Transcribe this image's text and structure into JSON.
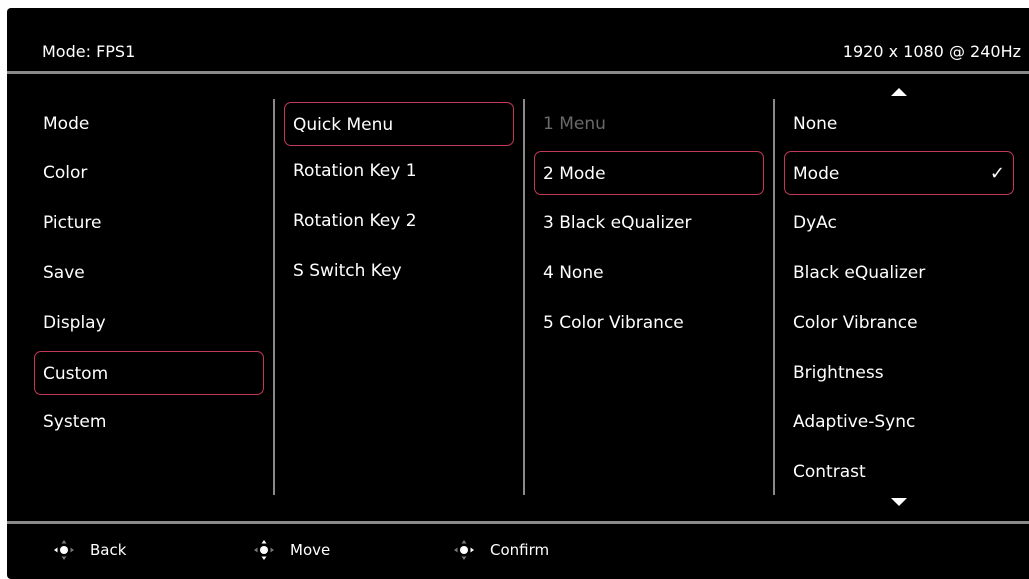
{
  "header": {
    "mode_label": "Mode: FPS1",
    "resolution": "1920 x 1080 @ 240Hz"
  },
  "menu": {
    "level1": [
      "Mode",
      "Color",
      "Picture",
      "Save",
      "Display",
      "Custom",
      "System"
    ],
    "level1_selected": "Custom",
    "level2": [
      "Quick Menu",
      "Rotation Key 1",
      "Rotation Key 2",
      "S Switch Key"
    ],
    "level2_selected": "Quick Menu",
    "level3": [
      "1 Menu",
      "2 Mode",
      "3 Black eQualizer",
      "4 None",
      "5 Color Vibrance"
    ],
    "level3_selected": "2 Mode",
    "level3_disabled": "1 Menu",
    "level4": [
      "None",
      "Mode",
      "DyAc",
      "Black eQualizer",
      "Color Vibrance",
      "Brightness",
      "Adaptive-Sync",
      "Contrast"
    ],
    "level4_selected": "Mode",
    "checkmark": "✓",
    "scroll_up_icon": "triangle-up",
    "scroll_down_icon": "triangle-down"
  },
  "footer": {
    "back": "Back",
    "move": "Move",
    "confirm": "Confirm"
  },
  "colors": {
    "background": "#000000",
    "selection_border": "#c23a57",
    "divider": "#8a8a8a",
    "disabled_text": "#6a6a6a"
  }
}
